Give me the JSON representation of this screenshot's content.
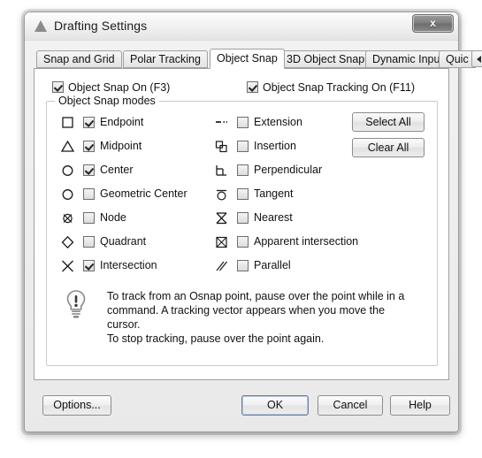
{
  "window": {
    "title": "Drafting Settings",
    "app_icon": "triangle-icon",
    "close_label": "x"
  },
  "tabs": {
    "items": [
      {
        "label": "Snap and Grid",
        "active": false
      },
      {
        "label": "Polar Tracking",
        "active": false
      },
      {
        "label": "Object Snap",
        "active": true
      },
      {
        "label": "3D Object Snap",
        "active": false
      },
      {
        "label": "Dynamic Input",
        "active": false
      },
      {
        "label": "Quic",
        "active": false
      }
    ],
    "scroll_left": "◄",
    "scroll_right": "►"
  },
  "top_options": {
    "object_snap_on": {
      "label": "Object Snap On (F3)",
      "checked": true
    },
    "object_snap_tracking_on": {
      "label": "Object Snap Tracking On (F11)",
      "checked": true
    }
  },
  "group": {
    "label": "Object Snap modes",
    "left_modes": [
      {
        "label": "Endpoint",
        "checked": true,
        "icon": "square-icon"
      },
      {
        "label": "Midpoint",
        "checked": true,
        "icon": "triangle-icon"
      },
      {
        "label": "Center",
        "checked": true,
        "icon": "circle-icon"
      },
      {
        "label": "Geometric Center",
        "checked": false,
        "icon": "circle-icon"
      },
      {
        "label": "Node",
        "checked": false,
        "icon": "crossed-circle-icon"
      },
      {
        "label": "Quadrant",
        "checked": false,
        "icon": "diamond-icon"
      },
      {
        "label": "Intersection",
        "checked": true,
        "icon": "x-cross-icon"
      }
    ],
    "right_modes": [
      {
        "label": "Extension",
        "checked": false,
        "icon": "dashed-line-icon"
      },
      {
        "label": "Insertion",
        "checked": false,
        "icon": "insertion-icon"
      },
      {
        "label": "Perpendicular",
        "checked": false,
        "icon": "perpendicular-icon"
      },
      {
        "label": "Tangent",
        "checked": false,
        "icon": "tangent-icon"
      },
      {
        "label": "Nearest",
        "checked": false,
        "icon": "hourglass-icon"
      },
      {
        "label": "Apparent intersection",
        "checked": false,
        "icon": "boxed-x-icon"
      },
      {
        "label": "Parallel",
        "checked": false,
        "icon": "parallel-lines-icon"
      }
    ],
    "select_all_label": "Select All",
    "clear_all_label": "Clear All"
  },
  "tip": {
    "icon": "lightbulb-icon",
    "text": "To track from an Osnap point, pause over the point while in a\ncommand.  A tracking vector appears when you move the cursor.\nTo stop tracking, pause over the point again."
  },
  "footer": {
    "options_label": "Options...",
    "ok_label": "OK",
    "cancel_label": "Cancel",
    "help_label": "Help"
  },
  "colors": {
    "dialog_bg": "#eeeeee",
    "page_bg": "#ffffff",
    "border": "#a0a0a0",
    "text": "#111111",
    "default_button_border": "#6b7f99"
  }
}
